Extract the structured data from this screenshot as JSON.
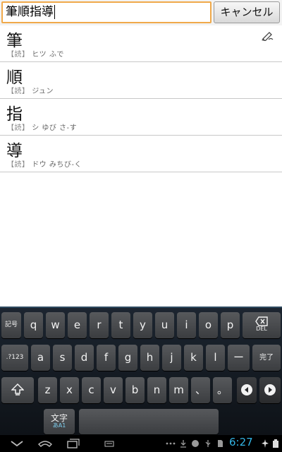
{
  "search": {
    "value": "筆順指導",
    "cancel_label": "キャンセル"
  },
  "results": [
    {
      "kanji": "筆",
      "reading_prefix": "【読】",
      "reading": "ヒツ ふで"
    },
    {
      "kanji": "順",
      "reading_prefix": "【読】",
      "reading": "ジュン"
    },
    {
      "kanji": "指",
      "reading_prefix": "【読】",
      "reading": "シ ゆび さ-す"
    },
    {
      "kanji": "導",
      "reading_prefix": "【読】",
      "reading": "ドウ みちび-く"
    }
  ],
  "keyboard": {
    "row1": [
      "記号",
      "q",
      "w",
      "e",
      "r",
      "t",
      "y",
      "u",
      "i",
      "o",
      "p",
      "DEL"
    ],
    "row2": [
      ".?123",
      "a",
      "s",
      "d",
      "f",
      "g",
      "h",
      "j",
      "k",
      "l",
      "ー",
      "完了"
    ],
    "row3": [
      "z",
      "x",
      "c",
      "v",
      "b",
      "n",
      "m",
      "、",
      "。"
    ],
    "mode_key": {
      "label": "文字",
      "sub": "あA1"
    }
  },
  "status": {
    "time": "6:27",
    "accent": "#33b5e5"
  }
}
